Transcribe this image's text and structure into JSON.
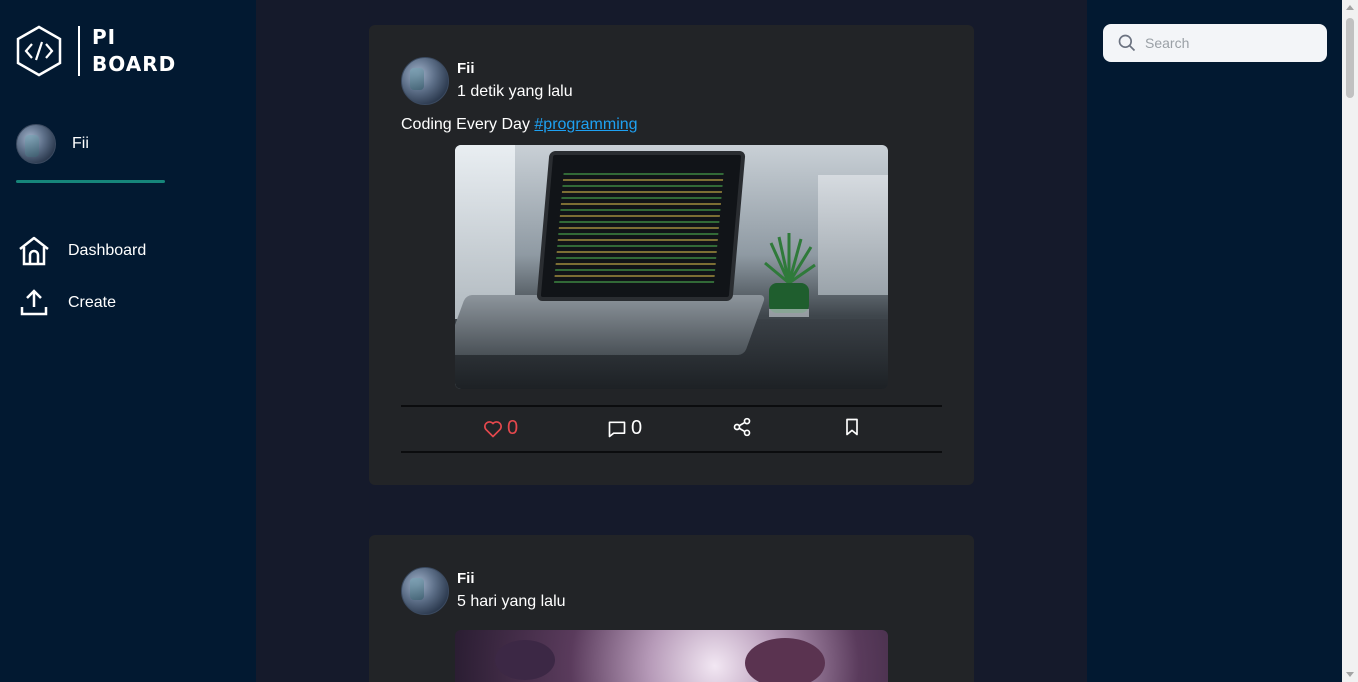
{
  "brand": {
    "line1": "PI",
    "line2": "BOARD"
  },
  "sidebar": {
    "profile_name": "Fii",
    "items": [
      {
        "label": "Dashboard",
        "icon": "home-icon"
      },
      {
        "label": "Create",
        "icon": "upload-icon"
      }
    ]
  },
  "posts": [
    {
      "author": "Fii",
      "time": "1 detik yang lalu",
      "caption": "Coding Every Day",
      "hashtag": "#programming",
      "likes": "0",
      "comments": "0"
    },
    {
      "author": "Fii",
      "time": "5 hari yang lalu"
    }
  ],
  "search": {
    "placeholder": "Search"
  },
  "colors": {
    "accent": "#16857a",
    "like": "#e5484d",
    "link": "#1ea1f2",
    "sidebar": "#021931",
    "card": "#222427"
  }
}
